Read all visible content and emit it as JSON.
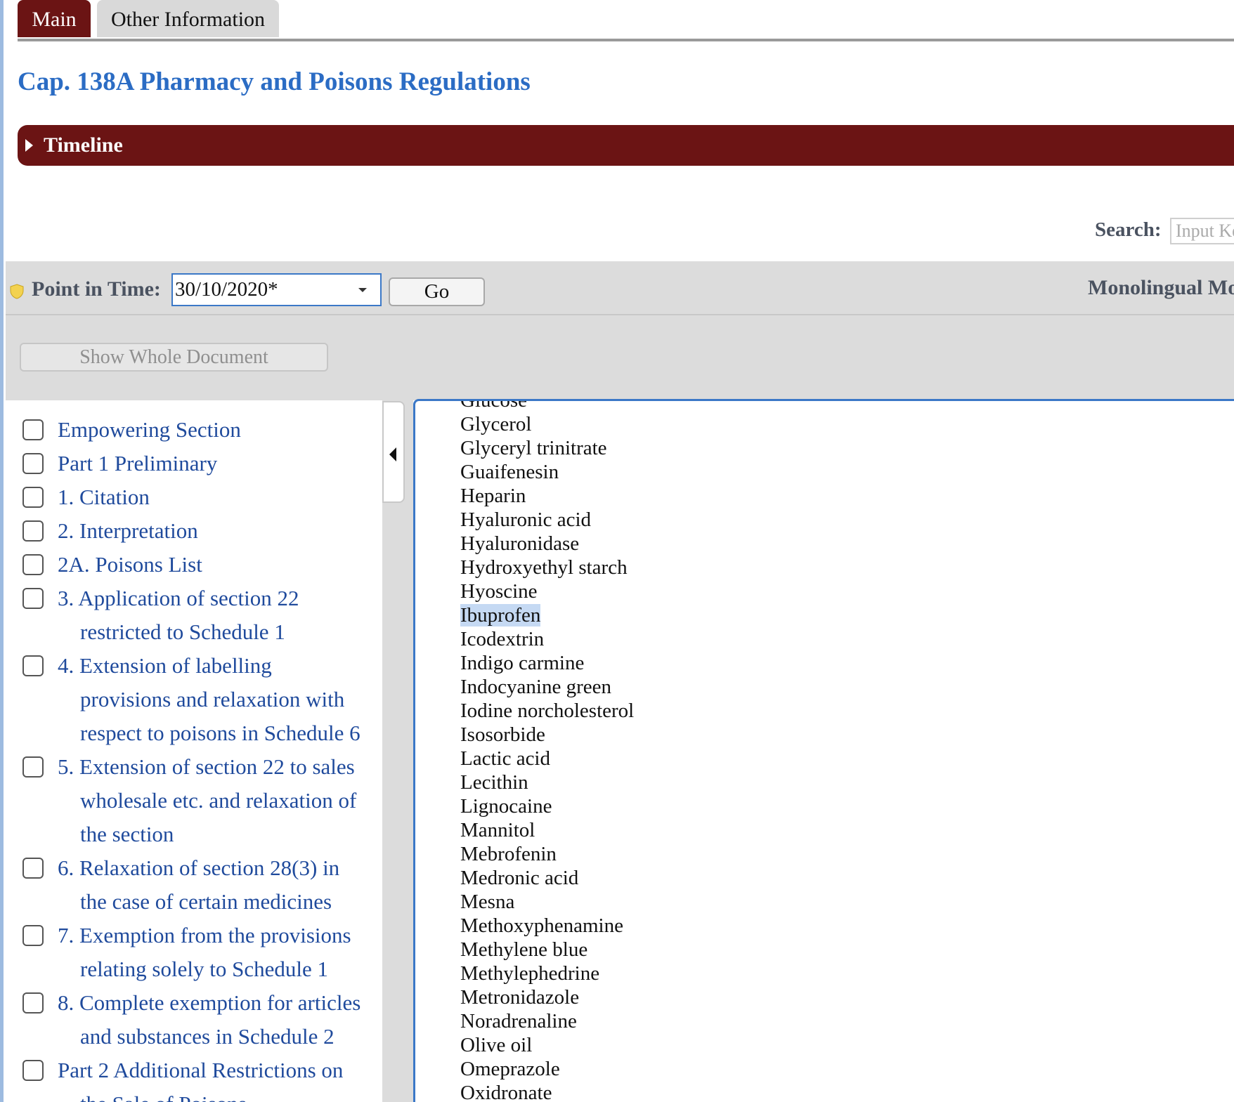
{
  "tabs": [
    {
      "label": "Main",
      "active": true
    },
    {
      "label": "Other Information",
      "active": false
    }
  ],
  "page_title": "Cap. 138A Pharmacy and Poisons Regulations",
  "timeline": {
    "label": "Timeline"
  },
  "search": {
    "label": "Search:",
    "placeholder": "Input Keyword"
  },
  "point_in_time": {
    "label": "Point in Time:",
    "value": "30/10/2020*",
    "go_label": "Go"
  },
  "mode_label": "Monolingual Mode",
  "show_whole_document_label": "Show Whole Document",
  "toc": [
    {
      "lines": [
        "Empowering Section"
      ]
    },
    {
      "lines": [
        "Part 1 Preliminary"
      ]
    },
    {
      "lines": [
        "1. Citation"
      ]
    },
    {
      "lines": [
        "2. Interpretation"
      ]
    },
    {
      "lines": [
        "2A. Poisons List"
      ]
    },
    {
      "lines": [
        "3. Application of section 22",
        "restricted to Schedule 1"
      ]
    },
    {
      "lines": [
        "4. Extension of labelling",
        "provisions and relaxation with",
        "respect to poisons in Schedule 6"
      ]
    },
    {
      "lines": [
        "5. Extension of section 22 to sales",
        "wholesale etc. and relaxation of",
        "the section"
      ]
    },
    {
      "lines": [
        "6. Relaxation of section 28(3) in",
        "the case of certain medicines"
      ]
    },
    {
      "lines": [
        "7. Exemption from the provisions",
        "relating solely to Schedule 1"
      ]
    },
    {
      "lines": [
        "8. Complete exemption for articles",
        "and substances in Schedule 2"
      ]
    },
    {
      "lines": [
        "Part 2 Additional Restrictions on",
        "the Sale of Poisons"
      ]
    }
  ],
  "content_list": [
    "Glucose",
    "Glycerol",
    "Glyceryl trinitrate",
    "Guaifenesin",
    "Heparin",
    "Hyaluronic acid",
    "Hyaluronidase",
    "Hydroxyethyl starch",
    "Hyoscine",
    "Ibuprofen",
    "Icodextrin",
    "Indigo carmine",
    "Indocyanine green",
    "Iodine norcholesterol",
    "Isosorbide",
    "Lactic acid",
    "Lecithin",
    "Lignocaine",
    "Mannitol",
    "Mebrofenin",
    "Medronic acid",
    "Mesna",
    "Methoxyphenamine",
    "Methylene blue",
    "Methylephedrine",
    "Metronidazole",
    "Noradrenaline",
    "Olive oil",
    "Omeprazole",
    "Oxidronate"
  ],
  "highlighted_item": "Ibuprofen",
  "colors": {
    "accent_dark_red": "#6b1414",
    "title_blue": "#2b6cc4",
    "link_blue": "#1f4a9c",
    "highlight": "#c5d9f3"
  }
}
